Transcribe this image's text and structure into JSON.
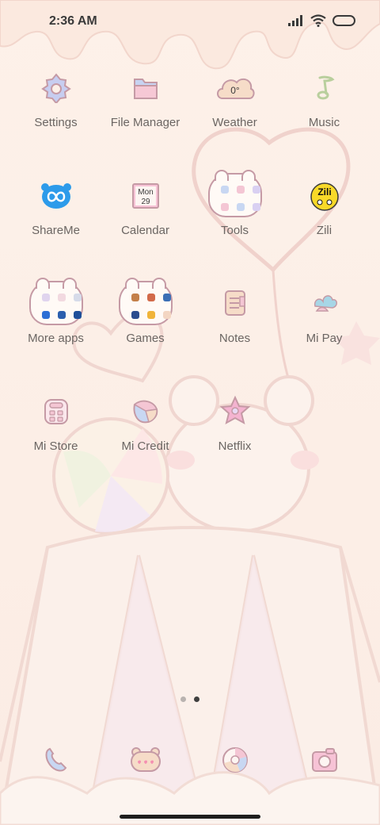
{
  "status_bar": {
    "time": "2:36 AM"
  },
  "apps": [
    {
      "label": "Settings",
      "icon": "settings-icon"
    },
    {
      "label": "File Manager",
      "icon": "folder-icon"
    },
    {
      "label": "Weather",
      "icon": "weather-cloud-icon",
      "icon_text": "0°"
    },
    {
      "label": "Music",
      "icon": "music-note-icon"
    },
    {
      "label": "ShareMe",
      "icon": "shareme-icon"
    },
    {
      "label": "Calendar",
      "icon": "calendar-icon",
      "icon_month": "Mon",
      "icon_day": "29"
    },
    {
      "label": "Tools",
      "icon": "folder-icon"
    },
    {
      "label": "Zili",
      "icon": "zili-icon",
      "icon_text": "Zili"
    },
    {
      "label": "More apps",
      "icon": "folder-icon"
    },
    {
      "label": "Games",
      "icon": "folder-icon"
    },
    {
      "label": "Notes",
      "icon": "notes-icon"
    },
    {
      "label": "Mi Pay",
      "icon": "mi-pay-icon"
    },
    {
      "label": "Mi Store",
      "icon": "mi-store-icon"
    },
    {
      "label": "Mi Credit",
      "icon": "mi-credit-icon"
    },
    {
      "label": "Netflix",
      "icon": "netflix-star-icon"
    }
  ],
  "dock": [
    {
      "icon": "phone-icon"
    },
    {
      "icon": "messages-bear-icon"
    },
    {
      "icon": "browser-icon"
    },
    {
      "icon": "camera-icon"
    }
  ],
  "colors": {
    "background": "#fdf0e8",
    "icon_outline": "#c59aa5",
    "label_text": "#6b6663"
  }
}
